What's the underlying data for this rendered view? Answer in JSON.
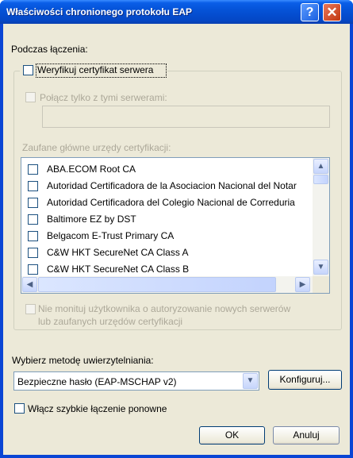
{
  "window": {
    "title": "Właściwości chronionego protokołu EAP",
    "help_glyph": "?",
    "close_glyph": "✕"
  },
  "connection": {
    "heading": "Podczas łączenia:",
    "verify_cert_label": "Weryfikuj certyfikat serwera",
    "connect_servers_label": "Połącz tylko z tymi serwerami:",
    "servers_value": "",
    "trusted_ca_label": "Zaufane główne urzędy certyfikacji:",
    "ca_list": [
      {
        "label": "ABA.ECOM Root CA",
        "checked": false
      },
      {
        "label": "Autoridad Certificadora de la Asociacion Nacional del Notar",
        "checked": false
      },
      {
        "label": "Autoridad Certificadora del Colegio Nacional de Correduria",
        "checked": false
      },
      {
        "label": "Baltimore EZ by DST",
        "checked": false
      },
      {
        "label": "Belgacom E-Trust Primary CA",
        "checked": false
      },
      {
        "label": "C&W HKT SecureNet CA Class A",
        "checked": false
      },
      {
        "label": "C&W HKT SecureNet CA Class B",
        "checked": false
      }
    ],
    "no_prompt_line1": "Nie monituj użytkownika o autoryzowanie nowych serwerów",
    "no_prompt_line2": "lub zaufanych urzędów certyfikacji"
  },
  "auth": {
    "method_label": "Wybierz metodę uwierzytelniania:",
    "method_value": "Bezpieczne hasło (EAP-MSCHAP v2)",
    "configure_label": "Konfiguruj...",
    "fast_reconnect_label": "Włącz szybkie łączenie ponowne"
  },
  "buttons": {
    "ok": "OK",
    "cancel": "Anuluj"
  },
  "scroll": {
    "up": "▲",
    "down": "▼",
    "left": "◀",
    "right": "▶",
    "dropdown": "▼"
  }
}
